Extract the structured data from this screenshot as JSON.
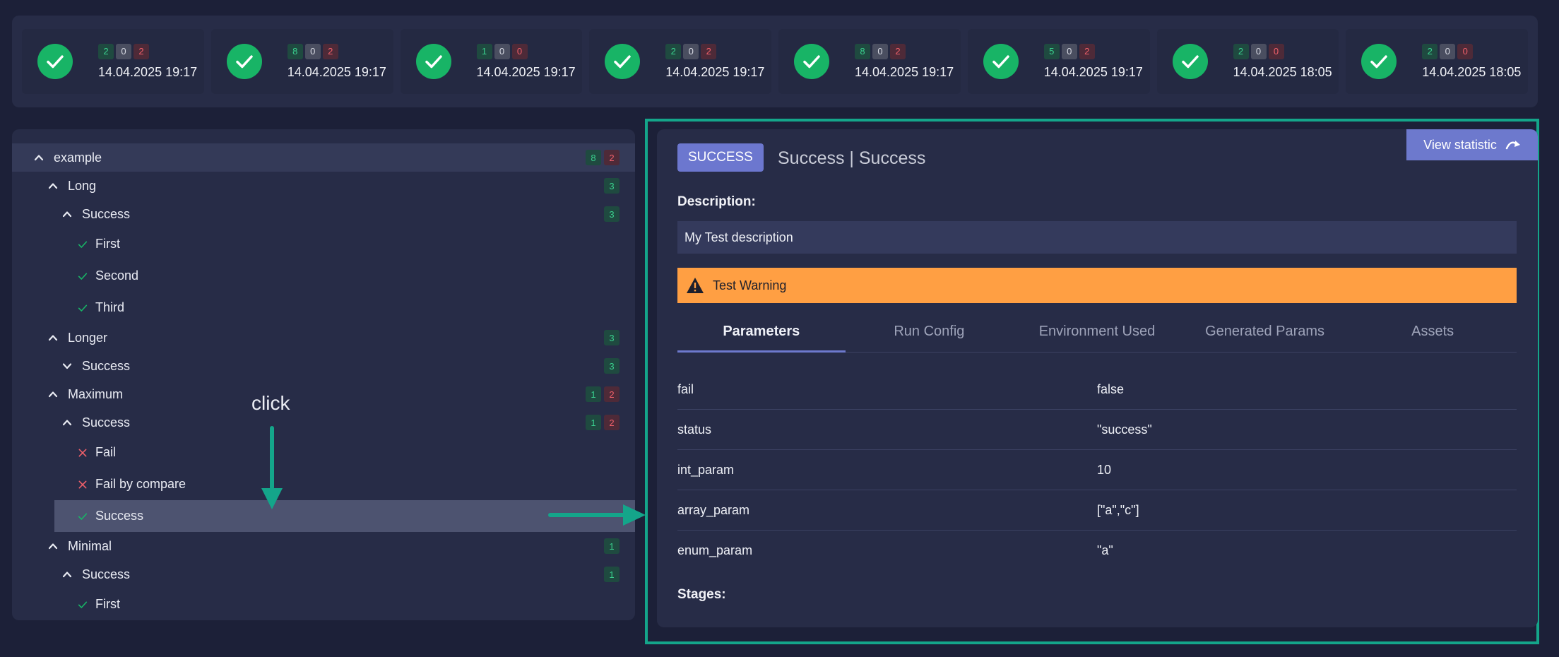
{
  "runs": [
    {
      "pass": "2",
      "skip": "0",
      "fail": "2",
      "date": "14.04.2025 19:17"
    },
    {
      "pass": "8",
      "skip": "0",
      "fail": "2",
      "date": "14.04.2025 19:17"
    },
    {
      "pass": "1",
      "skip": "0",
      "fail": "0",
      "date": "14.04.2025 19:17"
    },
    {
      "pass": "2",
      "skip": "0",
      "fail": "2",
      "date": "14.04.2025 19:17"
    },
    {
      "pass": "8",
      "skip": "0",
      "fail": "2",
      "date": "14.04.2025 19:17"
    },
    {
      "pass": "5",
      "skip": "0",
      "fail": "2",
      "date": "14.04.2025 19:17"
    },
    {
      "pass": "2",
      "skip": "0",
      "fail": "0",
      "date": "14.04.2025 18:05"
    },
    {
      "pass": "2",
      "skip": "0",
      "fail": "0",
      "date": "14.04.2025 18:05"
    }
  ],
  "tree": [
    {
      "label": "example",
      "level": 0,
      "type": "group",
      "chevron": "up",
      "root": true,
      "pass": "8",
      "fail": "2"
    },
    {
      "label": "Long",
      "level": 1,
      "type": "group",
      "chevron": "up",
      "pass": "3"
    },
    {
      "label": "Success",
      "level": 2,
      "type": "group",
      "chevron": "up",
      "pass": "3"
    },
    {
      "label": "First",
      "level": 3,
      "type": "leaf",
      "status": "pass"
    },
    {
      "label": "Second",
      "level": 3,
      "type": "leaf",
      "status": "pass"
    },
    {
      "label": "Third",
      "level": 3,
      "type": "leaf",
      "status": "pass"
    },
    {
      "label": "Longer",
      "level": 1,
      "type": "group",
      "chevron": "up",
      "pass": "3"
    },
    {
      "label": "Success",
      "level": 2,
      "type": "group",
      "chevron": "down",
      "pass": "3"
    },
    {
      "label": "Maximum",
      "level": 1,
      "type": "group",
      "chevron": "up",
      "pass": "1",
      "fail": "2"
    },
    {
      "label": "Success",
      "level": 2,
      "type": "group",
      "chevron": "up",
      "pass": "1",
      "fail": "2"
    },
    {
      "label": "Fail",
      "level": 3,
      "type": "leaf",
      "status": "fail"
    },
    {
      "label": "Fail by compare",
      "level": 3,
      "type": "leaf",
      "status": "fail"
    },
    {
      "label": "Success",
      "level": 3,
      "type": "leaf",
      "status": "pass",
      "selected": true
    },
    {
      "label": "Minimal",
      "level": 1,
      "type": "group",
      "chevron": "up",
      "pass": "1"
    },
    {
      "label": "Success",
      "level": 2,
      "type": "group",
      "chevron": "up",
      "pass": "1"
    },
    {
      "label": "First",
      "level": 3,
      "type": "leaf",
      "status": "pass"
    }
  ],
  "annotation": {
    "click_label": "click"
  },
  "detail": {
    "status_chip": "SUCCESS",
    "title": "Success | Success",
    "view_statistic": "View statistic",
    "description_label": "Description:",
    "description": "My Test description",
    "warning": "Test Warning",
    "tabs": [
      "Parameters",
      "Run Config",
      "Environment Used",
      "Generated Params",
      "Assets"
    ],
    "active_tab": "Parameters",
    "params": [
      {
        "key": "fail",
        "value": "false"
      },
      {
        "key": "status",
        "value": "\"success\""
      },
      {
        "key": "int_param",
        "value": "10"
      },
      {
        "key": "array_param",
        "value": "[\"a\",\"c\"]"
      },
      {
        "key": "enum_param",
        "value": "\"a\""
      }
    ],
    "stages_label": "Stages:"
  },
  "colors": {
    "background": "#1c2038",
    "panel": "#272c47",
    "pass": "#18b466",
    "fail": "#f0606a",
    "accent": "#6d79cd",
    "warning": "#ff9f43",
    "annotation": "#14a58a"
  }
}
